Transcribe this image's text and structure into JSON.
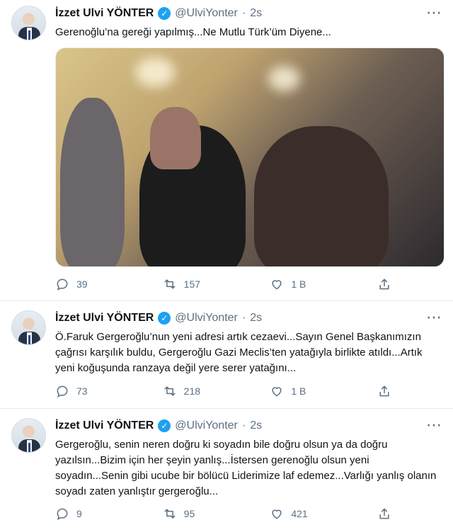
{
  "tweets": [
    {
      "author_name": "İzzet Ulvi YÖNTER",
      "handle": "@UlviYonter",
      "separator": "·",
      "time": "2s",
      "text": "Gerenoğlu’na gereği yapılmış...Ne Mutlu Türk’üm Diyene...",
      "has_media": true,
      "reply_count": "39",
      "retweet_count": "157",
      "like_count": "1 B"
    },
    {
      "author_name": "İzzet Ulvi YÖNTER",
      "handle": "@UlviYonter",
      "separator": "·",
      "time": "2s",
      "text": "Ö.Faruk Gergeroğlu’nun yeni adresi artık cezaevi...Sayın Genel Başkanımızın çağrısı karşılık buldu, Gergeroğlu Gazi Meclis’ten yatağıyla birlikte atıldı...Artık yeni koğuşunda ranzaya değil yere serer yatağını...",
      "has_media": false,
      "reply_count": "73",
      "retweet_count": "218",
      "like_count": "1 B"
    },
    {
      "author_name": "İzzet Ulvi YÖNTER",
      "handle": "@UlviYonter",
      "separator": "·",
      "time": "2s",
      "text": "Gergeroğlu, senin neren doğru ki soyadın bile doğru olsun ya da doğru yazılsın...Bizim için her şeyin yanlış...İstersen gerenoğlu olsun yeni soyadın...Senin gibi ucube bir bölücü Liderimize laf edemez...Varlığı yanlış olanın soyadı zaten yanlıştır gergeroğlu...",
      "has_media": false,
      "reply_count": "9",
      "retweet_count": "95",
      "like_count": "421"
    }
  ],
  "icons": {
    "verified": "verified-badge-icon",
    "more": "more-options-icon",
    "reply": "reply-icon",
    "retweet": "retweet-icon",
    "like": "heart-icon",
    "share": "share-icon"
  },
  "colors": {
    "accent": "#1da1f2",
    "secondary_text": "#5b7083",
    "divider": "#e6ecf0"
  }
}
